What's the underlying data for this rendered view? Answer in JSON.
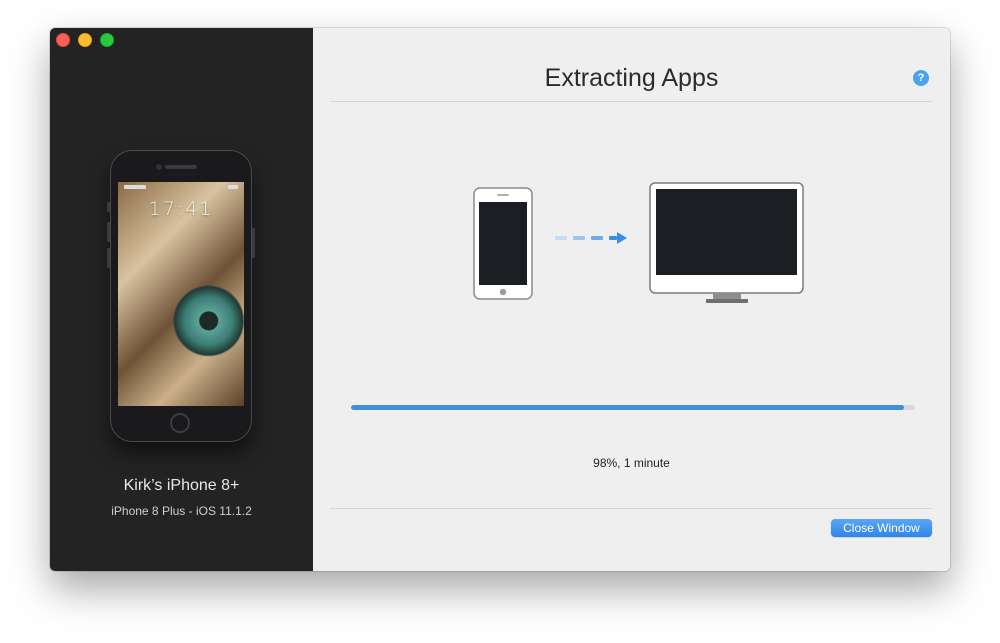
{
  "window": {
    "title": "Extracting Apps"
  },
  "device": {
    "name": "Kirk’s iPhone 8+",
    "info": "iPhone 8 Plus - iOS 11.1.2",
    "lock_time": "17:41"
  },
  "help": {
    "label": "?"
  },
  "progress": {
    "percent": 98,
    "label": "98%, 1 minute"
  },
  "actions": {
    "close_label": "Close Window"
  },
  "icons": {
    "help": "question-icon",
    "source": "phone-icon",
    "transfer": "dashed-arrow-icon",
    "target": "computer-icon"
  },
  "colors": {
    "accent": "#3f8fdd",
    "sidebar": "#232323",
    "content": "#efefef"
  }
}
